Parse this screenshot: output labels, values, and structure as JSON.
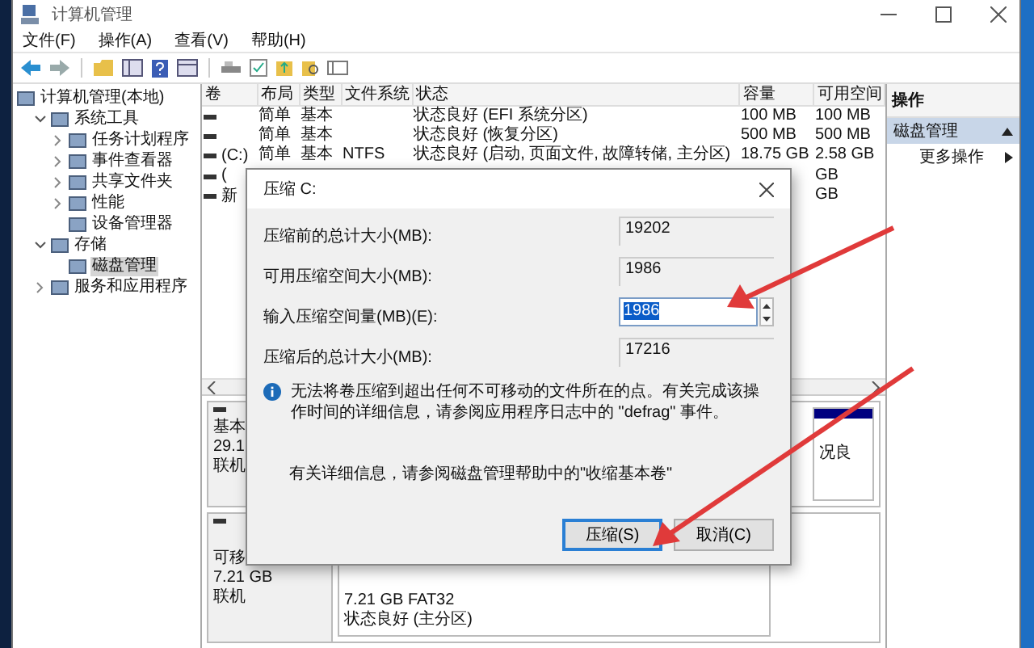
{
  "window": {
    "title": "计算机管理"
  },
  "menu": [
    "文件(F)",
    "操作(A)",
    "查看(V)",
    "帮助(H)"
  ],
  "tree": [
    {
      "label": "计算机管理(本地)",
      "selected": false,
      "children": [
        {
          "label": "系统工具",
          "expanded": true,
          "selected": false,
          "children": [
            {
              "label": "任务计划程序",
              "expanded": false,
              "selected": false
            },
            {
              "label": "事件查看器",
              "expanded": false,
              "selected": false
            },
            {
              "label": "共享文件夹",
              "expanded": false,
              "selected": false
            },
            {
              "label": "性能",
              "expanded": false,
              "selected": false
            },
            {
              "label": "设备管理器",
              "selected": false
            }
          ]
        },
        {
          "label": "存储",
          "expanded": true,
          "selected": false,
          "children": [
            {
              "label": "磁盘管理",
              "selected": true
            }
          ]
        },
        {
          "label": "服务和应用程序",
          "expanded": false,
          "selected": false
        }
      ]
    }
  ],
  "table": {
    "columns": [
      "卷",
      "布局",
      "类型",
      "文件系统",
      "状态",
      "容量",
      "可用空间"
    ],
    "rows": [
      {
        "cells": [
          "",
          "简单",
          "基本",
          "",
          "状态良好 (EFI 系统分区)",
          "100 MB",
          "100 MB"
        ]
      },
      {
        "cells": [
          "",
          "简单",
          "基本",
          "",
          "状态良好 (恢复分区)",
          "500 MB",
          "500 MB"
        ]
      },
      {
        "cells": [
          "(C:)",
          "简单",
          "基本",
          "NTFS",
          "状态良好 (启动, 页面文件, 故障转储, 主分区)",
          "18.75 GB",
          "2.58 GB"
        ]
      },
      {
        "cells": [
          "(",
          "",
          "",
          "",
          "",
          "",
          "GB"
        ]
      },
      {
        "cells": [
          "新",
          "",
          "",
          "",
          "",
          "",
          "GB"
        ]
      }
    ]
  },
  "disks": [
    {
      "info": [
        "基本",
        "29.1",
        "联机"
      ],
      "partitions": [
        {
          "color": "#000080",
          "lines": [
            "况良"
          ]
        }
      ]
    },
    {
      "info": [
        "可移",
        "7.21 GB",
        "联机"
      ],
      "partitions": [
        {
          "lines": [
            "7.21 GB FAT32",
            "状态良好 (主分区)"
          ]
        }
      ]
    }
  ],
  "actions": {
    "title": "操作",
    "items": [
      {
        "label": "磁盘管理",
        "kind": "section",
        "selected": true
      },
      {
        "label": "更多操作",
        "kind": "link",
        "selected": false
      }
    ]
  },
  "dialog": {
    "title": "压缩 C:",
    "fields": [
      {
        "label": "压缩前的总计大小(MB):",
        "value": "19202",
        "kind": "display"
      },
      {
        "label": "可用压缩空间大小(MB):",
        "value": "1986",
        "kind": "display"
      },
      {
        "label": "输入压缩空间量(MB)(E):",
        "value": "1986",
        "kind": "spin"
      },
      {
        "label": "压缩后的总计大小(MB):",
        "value": "17216",
        "kind": "display"
      }
    ],
    "info": "无法将卷压缩到超出任何不可移动的文件所在的点。有关完成该操作时间的详细信息，请参阅应用程序日志中的 \"defrag\" 事件。",
    "help": "有关详细信息，请参阅磁盘管理帮助中的\"收缩基本卷\"",
    "buttons": [
      {
        "label": "压缩(S)",
        "default": true
      },
      {
        "label": "取消(C)",
        "default": false
      }
    ]
  }
}
